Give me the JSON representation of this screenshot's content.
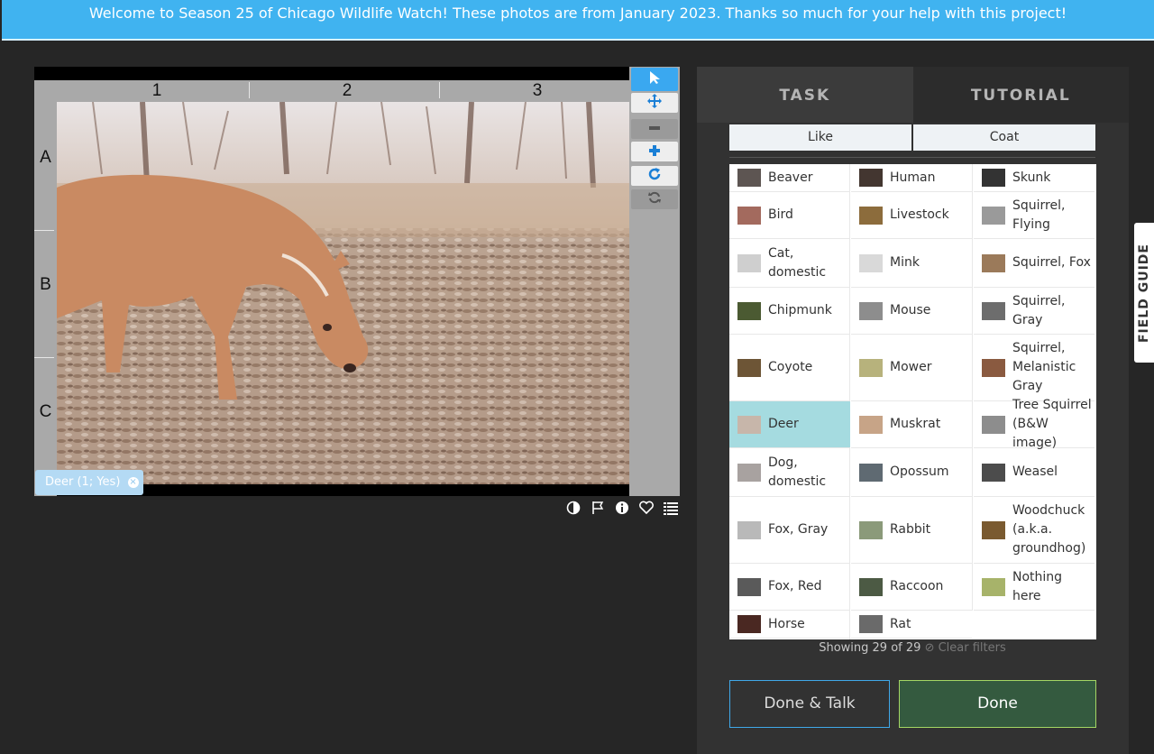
{
  "banner": {
    "text": "Welcome to Season 25 of Chicago Wildlife Watch! These photos are from January 2023. Thanks so much for your help with this project!"
  },
  "viewer": {
    "columns": [
      "1",
      "2",
      "3"
    ],
    "rows": [
      "A",
      "B",
      "C"
    ],
    "annotation_chip": "Deer (1; Yes)"
  },
  "toolbar": {
    "tools": [
      "pointer-icon",
      "move-icon",
      "zoom-out-icon",
      "zoom-in-icon",
      "rotate-icon",
      "reset-icon"
    ]
  },
  "image_actions": [
    "contrast-icon",
    "flag-icon",
    "info-icon",
    "heart-icon",
    "list-icon"
  ],
  "tabs": {
    "task": "TASK",
    "tutorial": "TUTORIAL"
  },
  "filters": {
    "like": "Like",
    "coat": "Coat"
  },
  "choices": {
    "col1": [
      "Beaver",
      "Bird",
      "Cat, domestic",
      "Chipmunk",
      "Coyote",
      "Deer",
      "Dog, domestic",
      "Fox, Gray",
      "Fox, Red",
      "Horse"
    ],
    "col2": [
      "Human",
      "Livestock",
      "Mink",
      "Mouse",
      "Mower",
      "Muskrat",
      "Opossum",
      "Rabbit",
      "Raccoon",
      "Rat"
    ],
    "col3": [
      "Skunk",
      "Squirrel, Flying",
      "Squirrel, Fox",
      "Squirrel, Gray",
      "Squirrel, Melanistic Gray",
      "Tree Squirrel (B&W image)",
      "Weasel",
      "Woodchuck (a.k.a. groundhog)",
      "Nothing here"
    ],
    "selected": "Deer"
  },
  "showing": {
    "text": "Showing 29 of 29",
    "clear": "Clear filters"
  },
  "buttons": {
    "done_talk": "Done & Talk",
    "done": "Done"
  },
  "field_guide": "FIELD GUIDE",
  "colors": {
    "banner": "#40b3f0",
    "selected": "#a5dbe0",
    "done": "#345a3f"
  }
}
